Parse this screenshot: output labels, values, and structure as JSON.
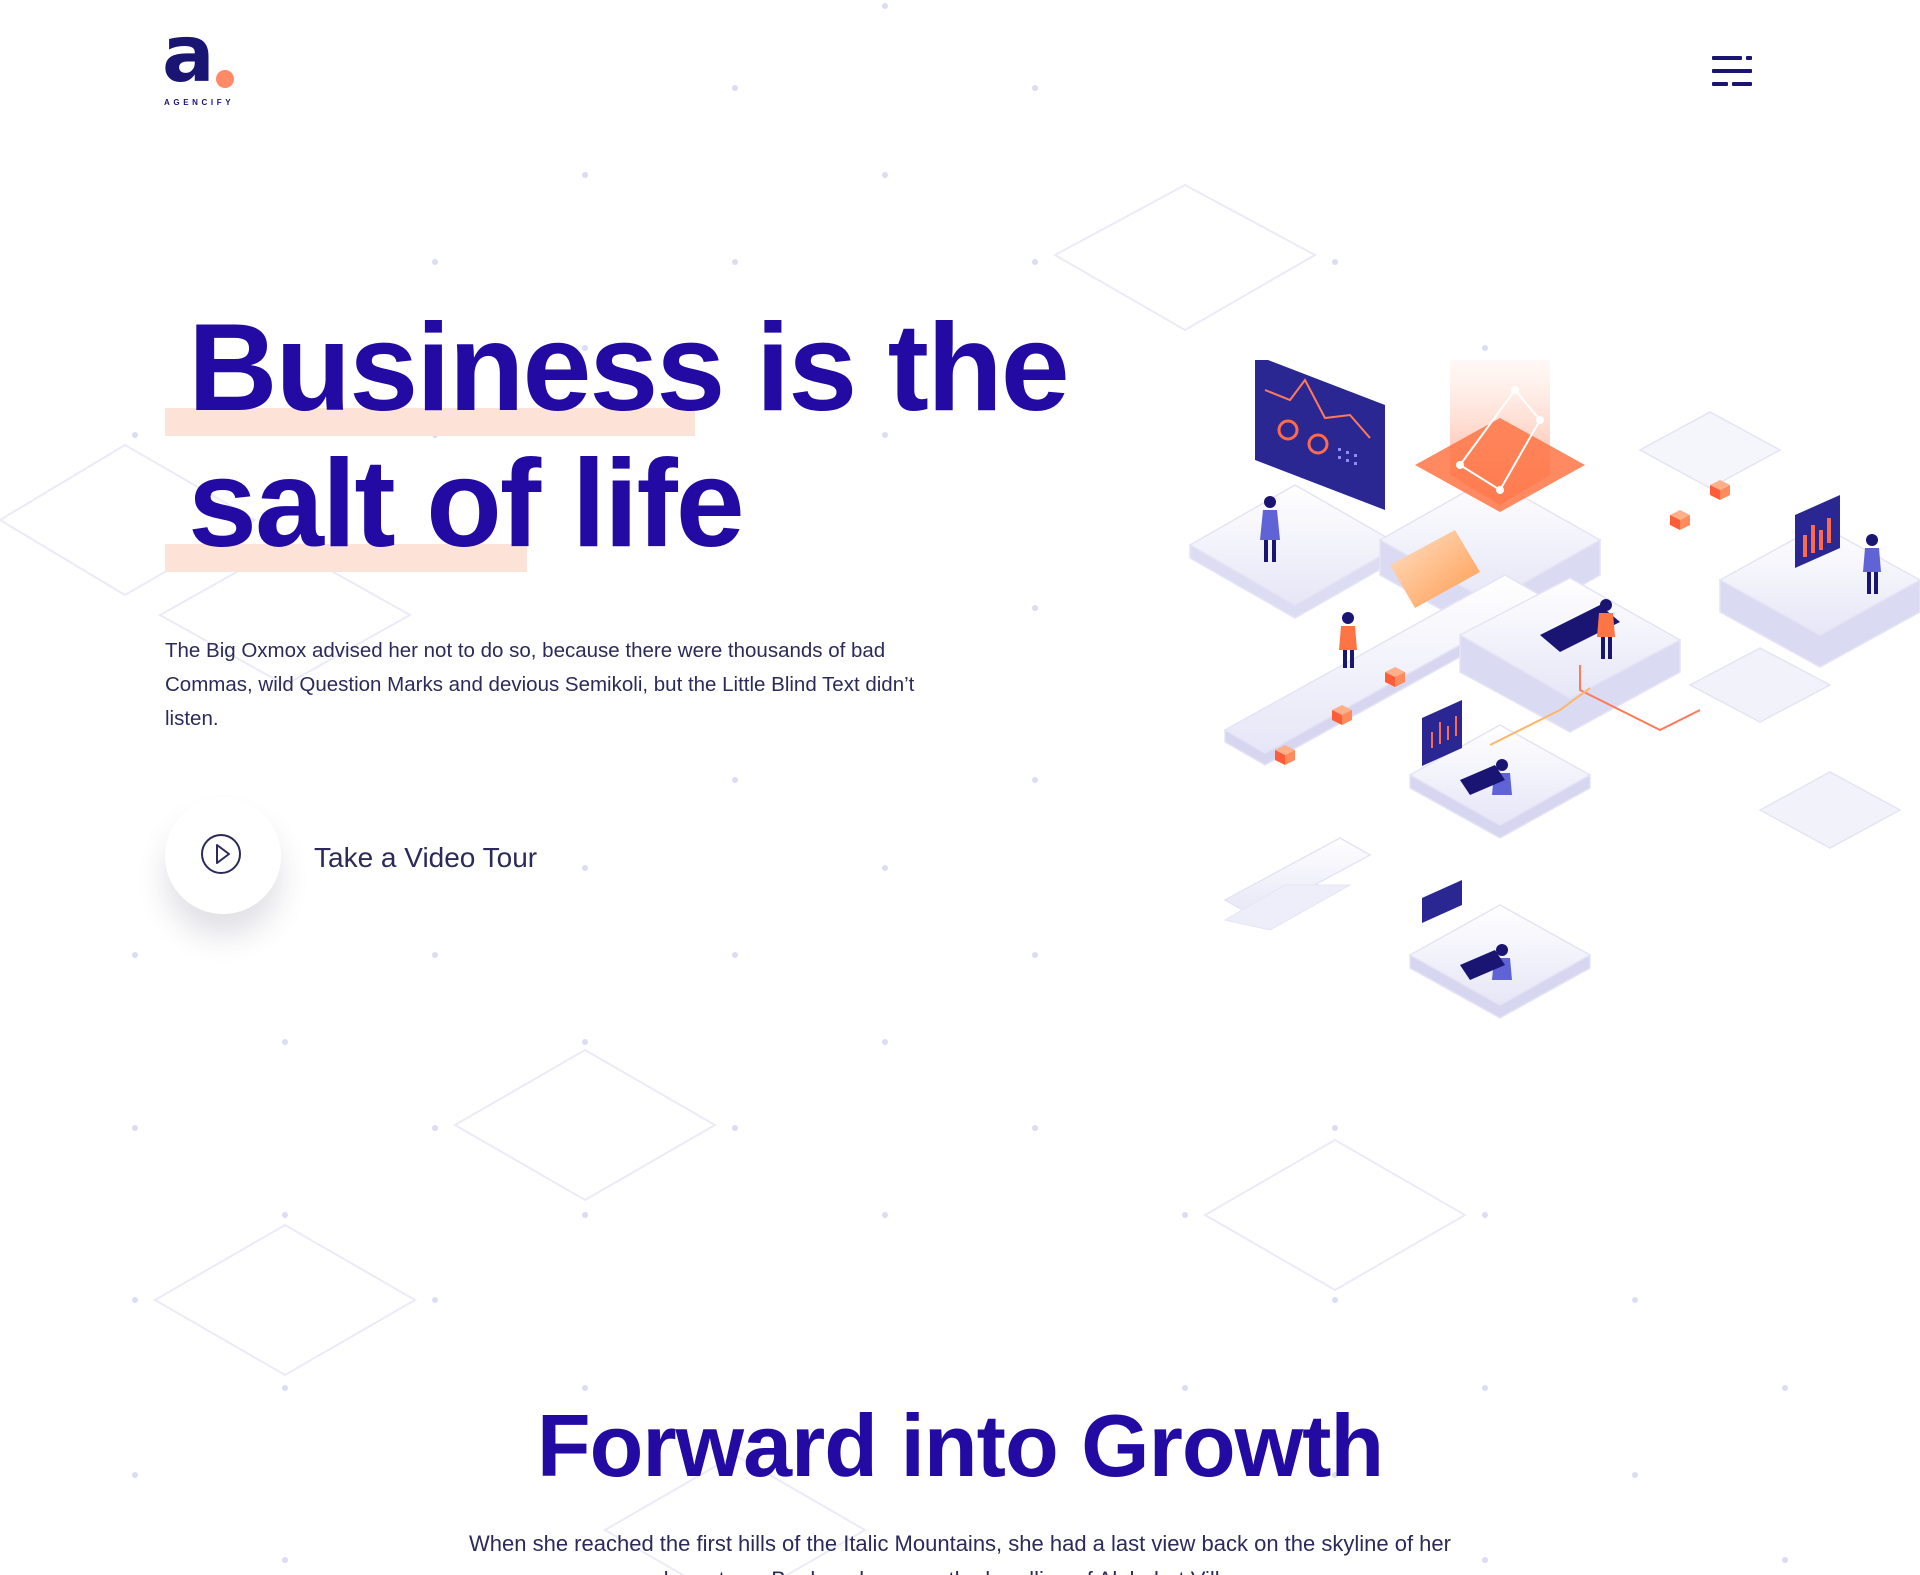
{
  "header": {
    "logo_letter": "a",
    "logo_wordmark": "AGENCIFY",
    "menu_icon": "hamburger-menu-icon"
  },
  "hero": {
    "headline_line1": "Business is the",
    "headline_line2": "salt of life",
    "paragraph": "The Big Oxmox advised her not to do so, because there were thousands of bad Commas, wild Question Marks and devious Semikoli, but the Little Blind Text didn’t listen.",
    "video_label": "Take a Video Tour",
    "video_icon": "play-icon",
    "illustration": "isometric-business-illustration"
  },
  "growth": {
    "title": "Forward into Growth",
    "paragraph": "When she reached the first hills of the Italic Mountains, she had a last view back on the skyline of her hometown Bookmarksgrove, the headline of Alphabet Village"
  },
  "colors": {
    "primary": "#230aa3",
    "logo": "#1a1573",
    "accent": "#ff8a65",
    "highlight": "#fde3d7",
    "text": "#2c2a5a"
  }
}
